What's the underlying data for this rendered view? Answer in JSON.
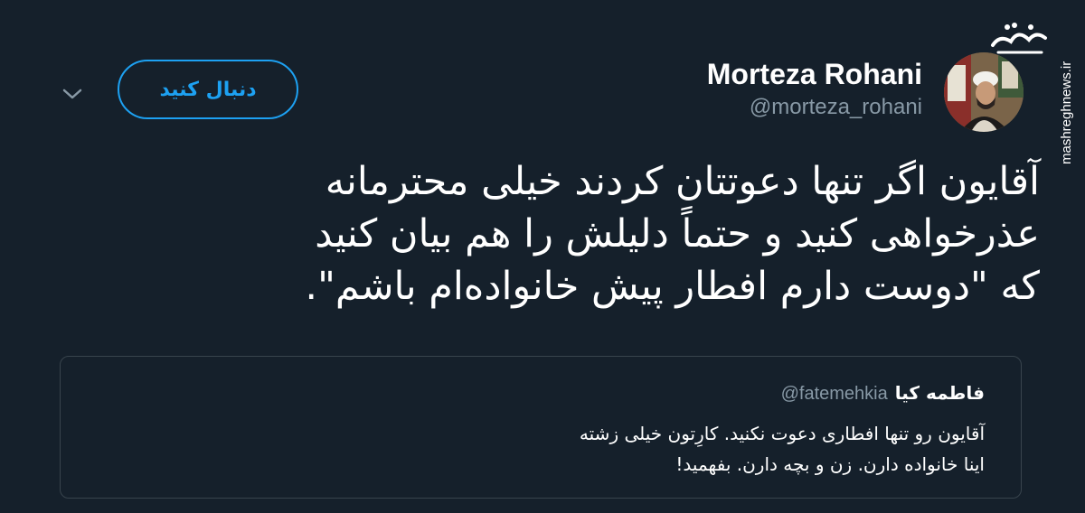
{
  "tweet": {
    "author_name": "Morteza Rohani",
    "author_handle": "@morteza_rohani",
    "follow_label": "دنبال کنید",
    "text": "آقایون اگر تنها دعوتتان کردند خیلی محترمانه\nعذرخواهی کنید و حتماً دلیلش را هم بیان کنید\nکه \"دوست دارم افطار پیش خانواده‌ام باشم\"."
  },
  "quoted_tweet": {
    "author_name": "فاطمه کیا",
    "author_handle": "@fatemehkia",
    "text": "آقایون رو تنها افطاری دعوت نکنید. کارِتون خیلی زشته\nاینا خانواده دارن. زن و بچه دارن. بفهمید!"
  },
  "watermark": {
    "logo_text": "مشرق",
    "url": "mashreghnews.ir"
  },
  "icons": {
    "menu": "chevron-down-icon",
    "avatar": "avatar"
  },
  "colors": {
    "background": "#15202b",
    "accent": "#1da1f2",
    "secondary_text": "#8899a6",
    "border": "#38444d"
  }
}
